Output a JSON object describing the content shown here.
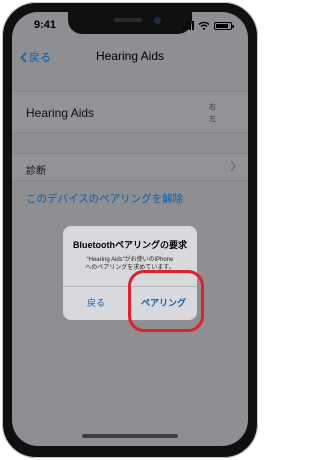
{
  "status_bar": {
    "time": "9:41"
  },
  "nav": {
    "back_label": "戻る",
    "title": "Hearing Aids"
  },
  "device": {
    "name": "Hearing Aids",
    "right": "右",
    "left": "左"
  },
  "diagnostics": {
    "label": "診断"
  },
  "unpair": {
    "label": "このデバイスのペアリングを解除"
  },
  "alert": {
    "title": "Bluetoothペアリングの要求",
    "message_line1": "“Hearing Aids”がお使いのiPhone",
    "message_line2": "へのペアリングを求めています。",
    "cancel_label": "戻る",
    "confirm_label": "ペアリング"
  },
  "colors": {
    "accent": "#0a60b0",
    "highlight": "#e0202e"
  }
}
